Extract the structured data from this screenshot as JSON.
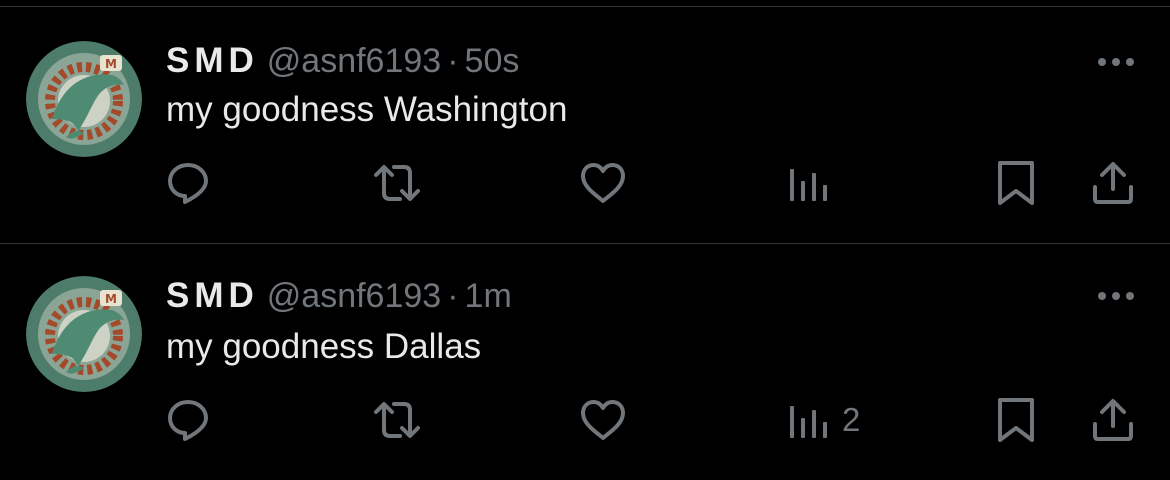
{
  "theme": {
    "background": "#000000",
    "text_primary": "#e7e9ea",
    "text_secondary": "#71767b",
    "divider": "#2f3336",
    "avatar_bg": "#4d7c6a",
    "avatar_ring": "#a44a2a"
  },
  "tweets": [
    {
      "author_name": "SMD",
      "handle": "@asnf6193",
      "separator": "·",
      "time": "50s",
      "text": "my goodness Washington",
      "views_count": "",
      "icons": {
        "avatar": "dolphin-logo-avatar",
        "more": "more-horizontal-icon",
        "reply": "reply-icon",
        "retweet": "retweet-icon",
        "like": "heart-icon",
        "views": "analytics-icon",
        "bookmark": "bookmark-icon",
        "share": "share-icon"
      }
    },
    {
      "author_name": "SMD",
      "handle": "@asnf6193",
      "separator": "·",
      "time": "1m",
      "text": "my goodness Dallas",
      "views_count": "2",
      "icons": {
        "avatar": "dolphin-logo-avatar",
        "more": "more-horizontal-icon",
        "reply": "reply-icon",
        "retweet": "retweet-icon",
        "like": "heart-icon",
        "views": "analytics-icon",
        "bookmark": "bookmark-icon",
        "share": "share-icon"
      }
    }
  ]
}
